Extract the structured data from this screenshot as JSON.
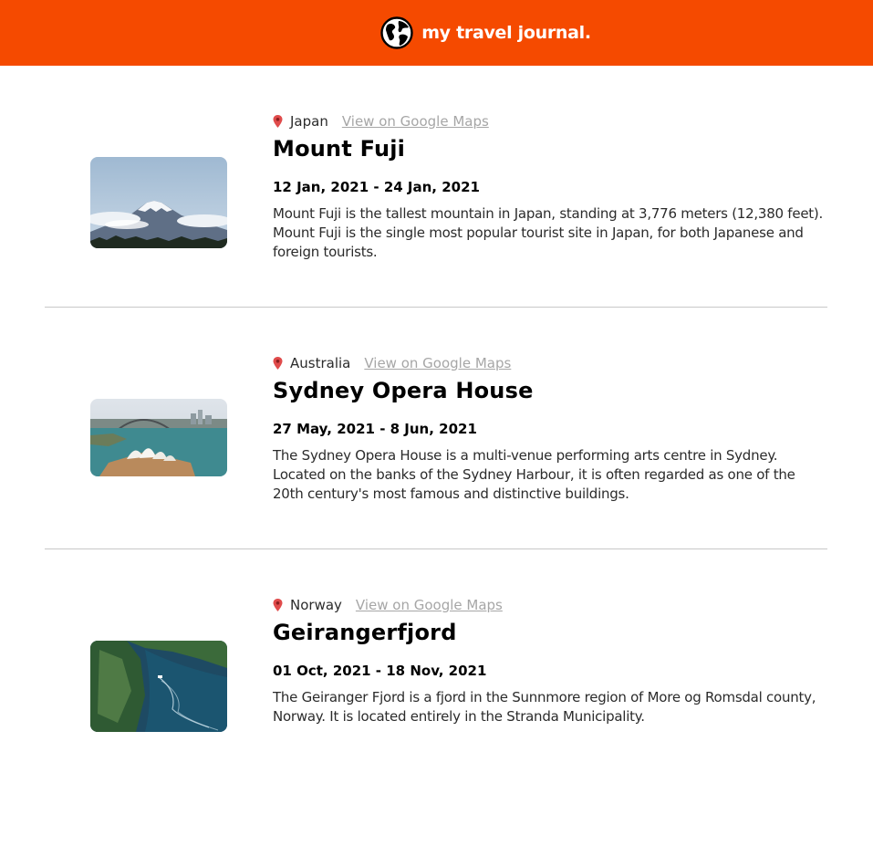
{
  "header": {
    "title": "my travel journal.",
    "logo_icon": "globe-icon",
    "background_color": "#f54a00"
  },
  "entries": [
    {
      "country": "Japan",
      "maps_link_label": "View on Google Maps",
      "title": "Mount Fuji",
      "dates": "12 Jan, 2021 - 24 Jan, 2021",
      "description": "Mount Fuji is the tallest mountain in Japan, standing at 3,776 meters (12,380 feet). Mount Fuji is the single most popular tourist site in Japan, for both Japanese and foreign tourists.",
      "image_icon": "mount-fuji-photo"
    },
    {
      "country": "Australia",
      "maps_link_label": "View on Google Maps",
      "title": "Sydney Opera House",
      "dates": "27 May, 2021 - 8 Jun, 2021",
      "description": "The Sydney Opera House is a multi-venue performing arts centre in Sydney. Located on the banks of the Sydney Harbour, it is often regarded as one of the 20th century's most famous and distinctive buildings.",
      "image_icon": "sydney-opera-house-photo"
    },
    {
      "country": "Norway",
      "maps_link_label": "View on Google Maps",
      "title": "Geirangerfjord",
      "dates": "01 Oct, 2021 - 18 Nov, 2021",
      "description": "The Geiranger Fjord is a fjord in the Sunnmore region of More og Romsdal county, Norway. It is located entirely in the Stranda Municipality.",
      "image_icon": "geirangerfjord-photo"
    }
  ],
  "colors": {
    "accent": "#f54a00",
    "link": "#a6a6a6",
    "pin": "#e04b4b",
    "divider": "#c8c8c8"
  }
}
